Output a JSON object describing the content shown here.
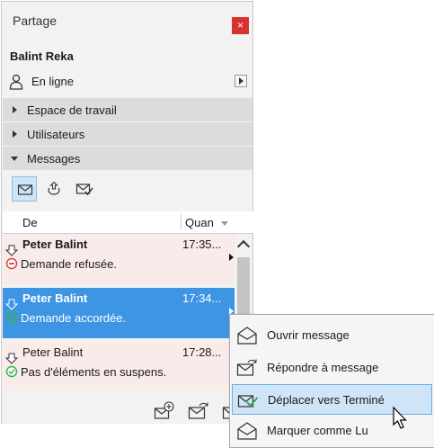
{
  "window": {
    "title": "Partage",
    "close_label": "×"
  },
  "user": {
    "name": "Balint Reka",
    "status": "En ligne"
  },
  "sections": [
    {
      "label": "Espace de travail",
      "expanded": false
    },
    {
      "label": "Utilisateurs",
      "expanded": false
    },
    {
      "label": "Messages",
      "expanded": true
    }
  ],
  "toolbar": {
    "icons": [
      "inbox-icon",
      "outbox-icon",
      "completed-messages-icon"
    ],
    "active": "inbox-icon"
  },
  "table": {
    "col_from": "De",
    "col_time": "Quan"
  },
  "messages": [
    {
      "from": "Peter Balint",
      "time": "17:35...",
      "text": "Demande refusée.",
      "status": "refused",
      "status_color": "#e0403a"
    },
    {
      "from": "Peter Balint",
      "time": "17:34...",
      "text": "Demande accordée.",
      "status": "granted",
      "status_color": "#3bb24a",
      "selected": true
    },
    {
      "from": "Peter Balint",
      "time": "17:28...",
      "text": "Pas d'éléments en suspens.",
      "status": "none-pending",
      "status_color": "#3bb24a"
    }
  ],
  "context_menu": {
    "items": [
      {
        "label": "Ouvrir message",
        "icon": "open-message-icon"
      },
      {
        "label": "Répondre à message",
        "icon": "reply-message-icon"
      },
      {
        "label": "Déplacer vers Terminé",
        "icon": "move-to-done-icon",
        "highlighted": true
      },
      {
        "label": "Marquer comme Lu",
        "icon": "mark-read-icon"
      }
    ]
  },
  "colors": {
    "selection": "#3d95e3",
    "highlight": "#cfe4f7",
    "close": "#d9312f",
    "pink_row": "#f8ebe9"
  }
}
